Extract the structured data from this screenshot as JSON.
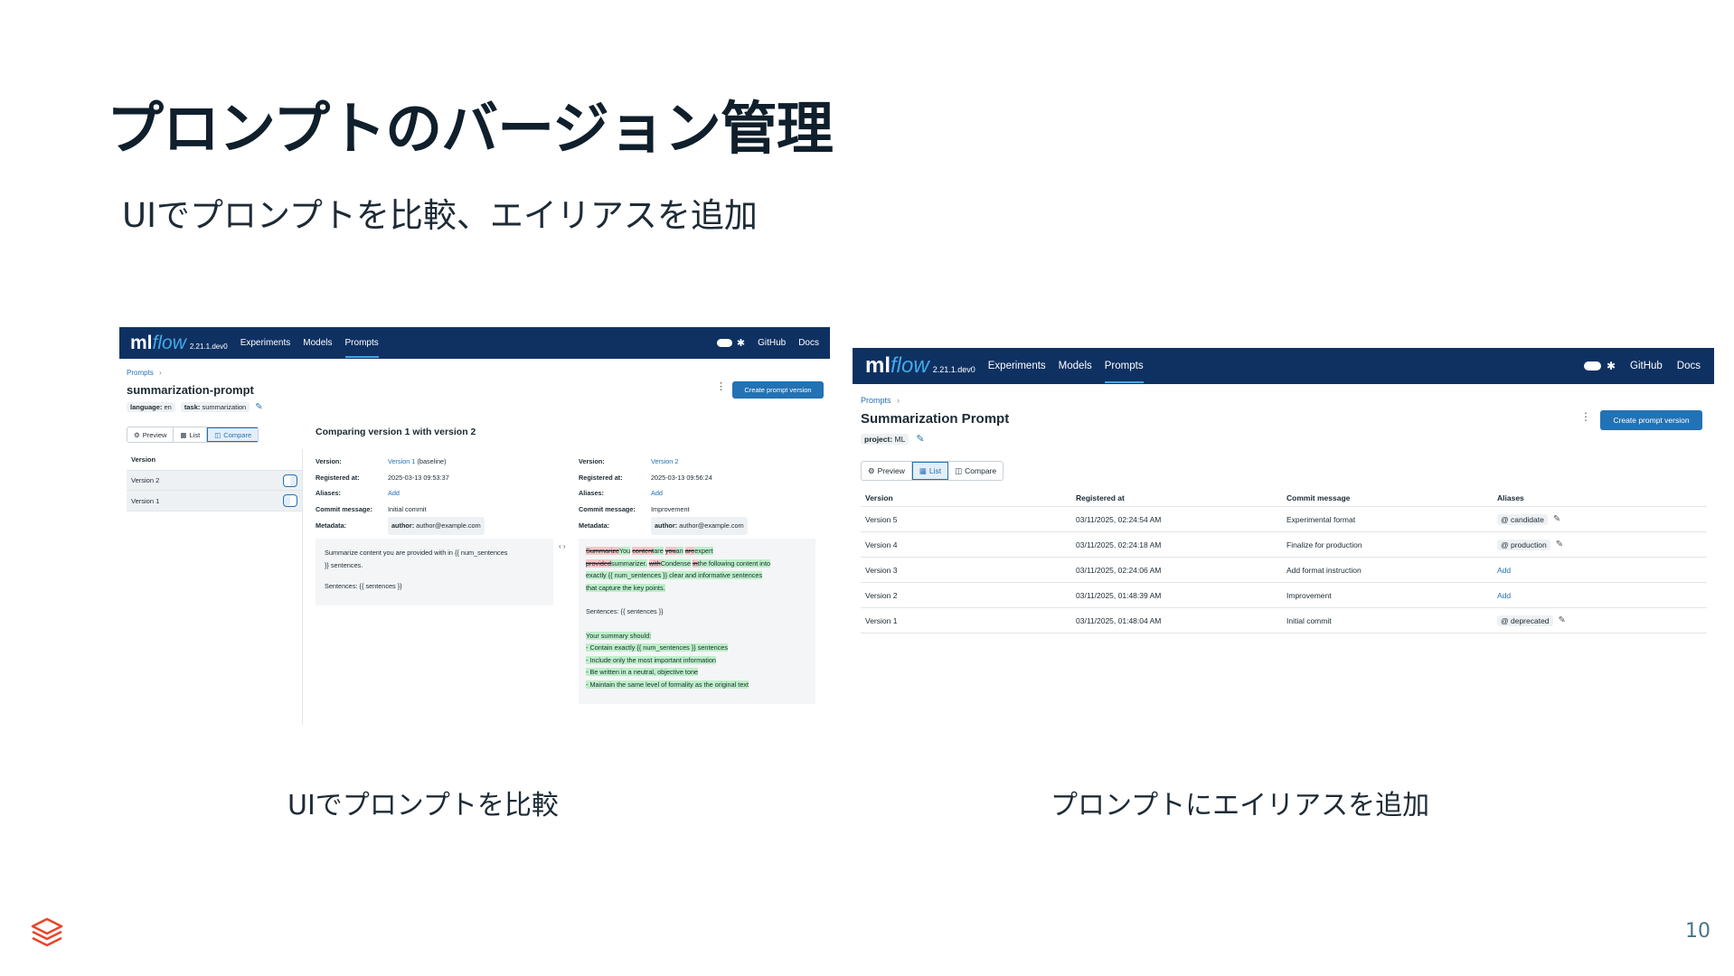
{
  "slide": {
    "title": "プロンプトのバージョン管理",
    "subtitle": "UIでプロンプトを比較、エイリアスを追加",
    "caption_left": "UIでプロンプトを比較",
    "caption_right": "プロンプトにエイリアスを追加",
    "page_number": "10",
    "brand_color": "#e8452c"
  },
  "nav": {
    "logo_ml": "ml",
    "logo_flow": "flow",
    "version": "2.21.1.dev0",
    "items": [
      "Experiments",
      "Models",
      "Prompts"
    ],
    "active": "Prompts",
    "github": "GitHub",
    "docs": "Docs",
    "bg_color": "#0e3162",
    "accent_color": "#43a8e6"
  },
  "shot1": {
    "breadcrumb": "Prompts",
    "breadcrumb_sep": "›",
    "prompt_name": "summarization-prompt",
    "tags": [
      {
        "key": "language:",
        "value": "en"
      },
      {
        "key": "task:",
        "value": "summarization"
      }
    ],
    "create_button": "Create prompt version",
    "tabs": [
      "Preview",
      "List",
      "Compare"
    ],
    "selected_tab": "Compare",
    "version_header": "Version",
    "versions": [
      "Version 2",
      "Version 1"
    ],
    "compare_title": "Comparing version 1 with version 2",
    "field_labels": [
      "Version:",
      "Registered at:",
      "Aliases:",
      "Commit message:",
      "Metadata:"
    ],
    "left": {
      "version_link": "Version 1",
      "version_suffix": "(baseline)",
      "registered": "2025-03-13 09:53:37",
      "aliases": "Add",
      "commit": "Initial commit",
      "metadata_key": "author:",
      "metadata_value": "author@example.com",
      "text_line1": "Summarize content you are provided with in {{ num_sentences",
      "text_line2": "}} sentences.",
      "text_line3": "Sentences: {{ sentences }}"
    },
    "right": {
      "version_link": "Version 2",
      "registered": "2025-03-13 09:56:24",
      "aliases": "Add",
      "commit": "Improvement",
      "metadata_key": "author:",
      "metadata_value": "author@example.com",
      "diff_line1": [
        "Summarize",
        "You",
        " ",
        "content",
        "are",
        " ",
        "you",
        "an",
        " ",
        "are",
        "expert"
      ],
      "diff_line2": [
        "provided",
        "summarizer.",
        " ",
        "with",
        "Condense",
        " ",
        "in",
        "the following content into"
      ],
      "diff_line3": [
        "exactly {{ num_sentences }} clear and informative sentences"
      ],
      "diff_line4": [
        "that capture the key points."
      ],
      "sentences_line": "Sentences: {{ sentences }}",
      "added_lines": [
        "Your summary should:",
        "- Contain exactly {{ num_sentences }} sentences",
        "- Include only the most important information",
        "- Be written in a neutral, objective tone",
        "- Maintain the same level of formality as the original text"
      ]
    },
    "diff_toggle": "‹ ›"
  },
  "shot2": {
    "breadcrumb": "Prompts",
    "breadcrumb_sep": "›",
    "prompt_name": "Summarization Prompt",
    "tag_key": "project:",
    "tag_value": "ML",
    "create_button": "Create prompt version",
    "tabs": [
      "Preview",
      "List",
      "Compare"
    ],
    "selected_tab": "List",
    "columns": [
      "Version",
      "Registered at",
      "Commit message",
      "Aliases"
    ],
    "rows": [
      {
        "version": "Version 5",
        "registered": "03/11/2025, 02:24:54 AM",
        "commit": "Experimental format",
        "alias": "@ candidate",
        "alias_type": "tag"
      },
      {
        "version": "Version 4",
        "registered": "03/11/2025, 02:24:18 AM",
        "commit": "Finalize for production",
        "alias": "@ production",
        "alias_type": "tag"
      },
      {
        "version": "Version 3",
        "registered": "03/11/2025, 02:24:06 AM",
        "commit": "Add format instruction",
        "alias": "Add",
        "alias_type": "link"
      },
      {
        "version": "Version 2",
        "registered": "03/11/2025, 01:48:39 AM",
        "commit": "Improvement",
        "alias": "Add",
        "alias_type": "link"
      },
      {
        "version": "Version 1",
        "registered": "03/11/2025, 01:48:04 AM",
        "commit": "Initial commit",
        "alias": "@ deprecated",
        "alias_type": "tag"
      }
    ]
  }
}
